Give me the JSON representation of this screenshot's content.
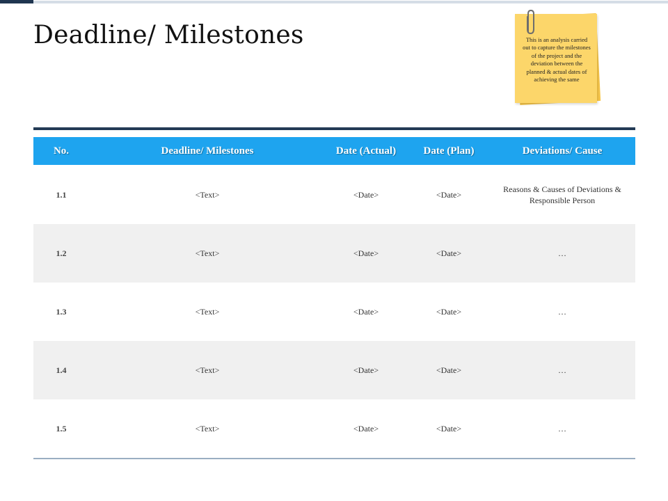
{
  "title": "Deadline/ Milestones",
  "note": {
    "text": "This is an analysis carried out to capture the milestones of the project and the deviation between the planned & actual dates of achieving the same"
  },
  "colors": {
    "header_bg": "#1ea4ef",
    "accent_dark": "#233a55",
    "note_yellow": "#fcd66a",
    "row_alt": "#f0f0f0"
  },
  "table": {
    "headers": [
      "No.",
      "Deadline/ Milestones",
      "Date (Actual)",
      "Date (Plan)",
      "Deviations/ Cause"
    ],
    "rows": [
      {
        "no": "1.1",
        "milestone": "<Text>",
        "actual": "<Date>",
        "plan": "<Date>",
        "deviation": "Reasons & Causes of Deviations & Responsible Person"
      },
      {
        "no": "1.2",
        "milestone": "<Text>",
        "actual": "<Date>",
        "plan": "<Date>",
        "deviation": "…"
      },
      {
        "no": "1.3",
        "milestone": "<Text>",
        "actual": "<Date>",
        "plan": "<Date>",
        "deviation": "…"
      },
      {
        "no": "1.4",
        "milestone": "<Text>",
        "actual": "<Date>",
        "plan": "<Date>",
        "deviation": "…"
      },
      {
        "no": "1.5",
        "milestone": "<Text>",
        "actual": "<Date>",
        "plan": "<Date>",
        "deviation": "…"
      }
    ]
  }
}
